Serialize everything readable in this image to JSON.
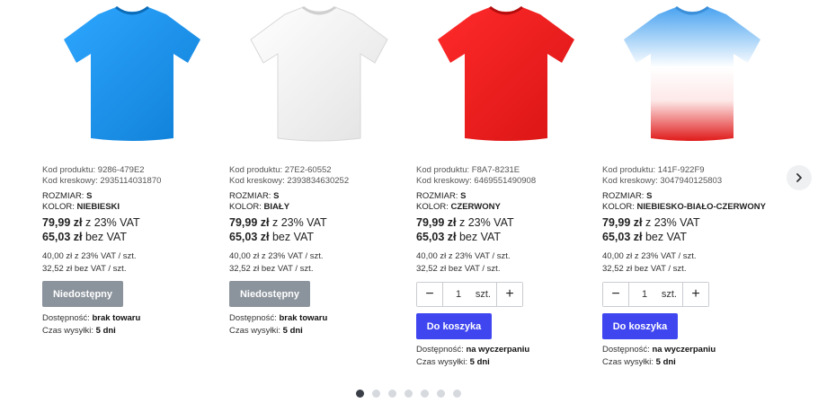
{
  "labels": {
    "product_code": "Kod produktu:",
    "barcode": "Kod kreskowy:",
    "size": "ROZMIAR:",
    "color": "KOLOR:",
    "vat_gross": "z 23% VAT",
    "vat_net": "bez VAT",
    "availability": "Dostępność:",
    "shipping": "Czas wysyłki:",
    "qty_unit": "szt.",
    "unavailable_btn": "Niedostępny",
    "cart_btn": "Do koszyka"
  },
  "products": [
    {
      "code": "9286-479E2",
      "barcode": "2935114031870",
      "size": "S",
      "color": "NIEBIESKI",
      "price_gross": "79,99 zł",
      "price_net": "65,03 zł",
      "unit_gross": "40,00 zł z 23% VAT / szt.",
      "unit_net": "32,52 zł bez VAT / szt.",
      "availability": "brak towaru",
      "shipping": "5 dni",
      "tshirt_color": "#1e90e8"
    },
    {
      "code": "27E2-60552",
      "barcode": "2393834630252",
      "size": "S",
      "color": "BIAŁY",
      "price_gross": "79,99 zł",
      "price_net": "65,03 zł",
      "unit_gross": "40,00 zł z 23% VAT / szt.",
      "unit_net": "32,52 zł bez VAT / szt.",
      "availability": "brak towaru",
      "shipping": "5 dni",
      "tshirt_color": "#f4f4f4"
    },
    {
      "code": "F8A7-8231E",
      "barcode": "6469551490908",
      "size": "S",
      "color": "CZERWONY",
      "price_gross": "79,99 zł",
      "price_net": "65,03 zł",
      "unit_gross": "40,00 zł z 23% VAT / szt.",
      "unit_net": "32,52 zł bez VAT / szt.",
      "quantity": "1",
      "availability": "na wyczerpaniu",
      "shipping": "5 dni",
      "tshirt_color": "#ee1c1c"
    },
    {
      "code": "141F-922F9",
      "barcode": "3047940125803",
      "size": "S",
      "color": "NIEBIESKO-BIAŁO-CZERWONY",
      "price_gross": "79,99 zł",
      "price_net": "65,03 zł",
      "unit_gross": "40,00 zł z 23% VAT / szt.",
      "unit_net": "32,52 zł bez VAT / szt.",
      "quantity": "1",
      "availability": "na wyczerpaniu",
      "shipping": "5 dni",
      "tshirt_color": "gradient"
    }
  ],
  "pagination": {
    "total": 7,
    "active": 1
  },
  "icons": {
    "next": "chevron-right-icon",
    "minus": "minus-icon",
    "plus": "plus-icon"
  },
  "colors": {
    "cart_button": "#4046ef",
    "unavailable_button": "#8b939c"
  }
}
